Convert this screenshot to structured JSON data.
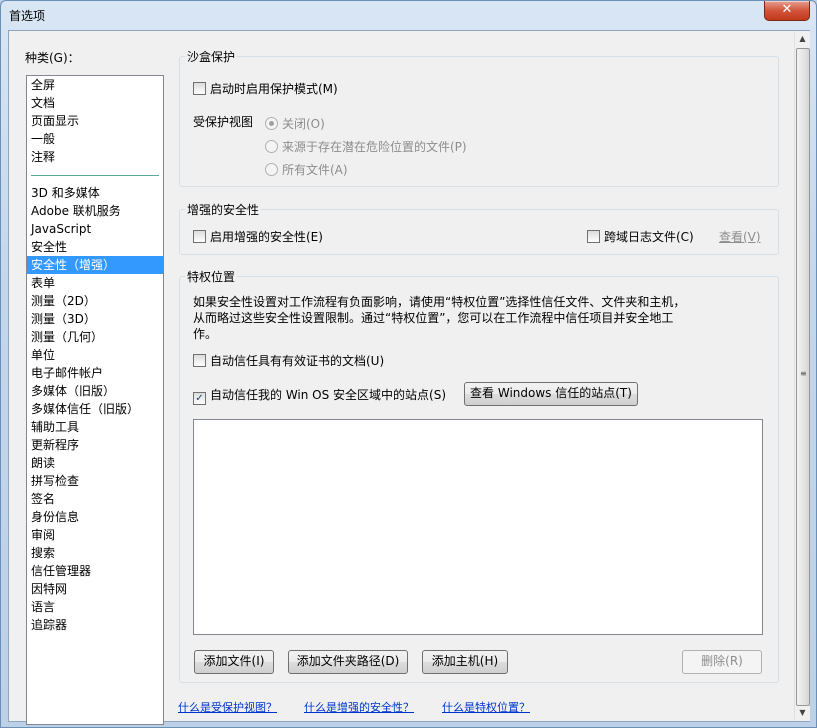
{
  "window": {
    "title": "首选项",
    "close_symbol": "✕"
  },
  "categories": {
    "label": "种类(G)：",
    "group1": [
      "全屏",
      "文档",
      "页面显示",
      "一般",
      "注释"
    ],
    "group2": [
      "3D 和多媒体",
      "Adobe 联机服务",
      "JavaScript",
      "安全性",
      "安全性（增强）",
      "表单",
      "测量（2D）",
      "测量（3D）",
      "测量（几何）",
      "单位",
      "电子邮件帐户",
      "多媒体（旧版）",
      "多媒体信任（旧版）",
      "辅助工具",
      "更新程序",
      "朗读",
      "拼写检查",
      "签名",
      "身份信息",
      "审阅",
      "搜索",
      "信任管理器",
      "因特网",
      "语言",
      "追踪器"
    ],
    "selected": "安全性（增强）"
  },
  "sandbox": {
    "title": "沙盒保护",
    "enable_protected_mode": {
      "label": "启动时启用保护模式(M)",
      "checked": false
    },
    "protected_view_label": "受保护视图",
    "options": [
      {
        "label": "关闭(O)",
        "selected": true
      },
      {
        "label": "来源于存在潜在危险位置的文件(P)",
        "selected": false
      },
      {
        "label": "所有文件(A)",
        "selected": false
      }
    ]
  },
  "enhanced": {
    "title": "增强的安全性",
    "enable_label": "启用增强的安全性(E)",
    "cross_domain_label": "跨域日志文件(C)",
    "view_label": "查看(V)"
  },
  "privileged": {
    "title": "特权位置",
    "description_line1": "如果安全性设置对工作流程有负面影响，请使用“特权位置”选择性信任文件、文件夹和主机，",
    "description_line2": "从而略过这些安全性设置限制。通过“特权位置”，您可以在工作流程中信任项目并安全地工",
    "description_line3": "作。",
    "trust_certified_label": "自动信任具有有效证书的文档(U)",
    "trust_win_os_label": "自动信任我的 Win OS 安全区域中的站点(S)",
    "view_windows_sites_button": "查看 Windows 信任的站点(T)",
    "add_file_button": "添加文件(I)",
    "add_folder_button": "添加文件夹路径(D)",
    "add_host_button": "添加主机(H)",
    "remove_button": "删除(R)"
  },
  "help_links": {
    "protected_view": "什么是受保护视图？",
    "enhanced_security": "什么是增强的安全性？",
    "privileged_locations": "什么是特权位置？"
  },
  "icons": {
    "close": "close-icon",
    "check": "checkmark-icon"
  }
}
